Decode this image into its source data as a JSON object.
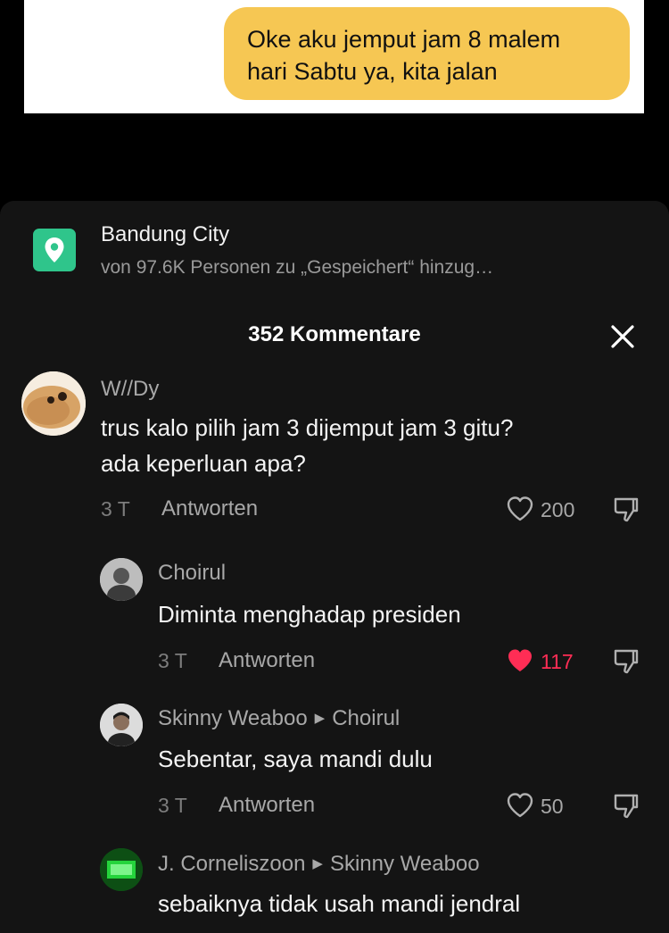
{
  "chat_preview": {
    "bubble_lines": [
      "Oke aku jemput jam 8 malem",
      "hari Sabtu ya, kita jalan"
    ]
  },
  "location": {
    "title": "Bandung City",
    "subtitle": "von 97.6K Personen zu „Gespeichert“ hinzug…",
    "icon": "location-pin-icon",
    "color": "#2fc58b"
  },
  "header": {
    "count_label": "352 Kommentare",
    "close_icon": "close-icon"
  },
  "comments": [
    {
      "user": "W//Dy",
      "text_lines": [
        "trus kalo pilih jam 3 dijemput jam 3 gitu?",
        "ada keperluan apa?"
      ],
      "time": "3 T",
      "reply_label": "Antworten",
      "likes": "200",
      "liked": false
    },
    {
      "user": "Choirul",
      "text_lines": [
        "Diminta menghadap presiden"
      ],
      "time": "3 T",
      "reply_label": "Antworten",
      "likes": "117",
      "liked": true
    },
    {
      "user": "Skinny Weaboo",
      "reply_to": "Choirul",
      "text_lines": [
        "Sebentar, saya mandi dulu"
      ],
      "time": "3 T",
      "reply_label": "Antworten",
      "likes": "50",
      "liked": false
    },
    {
      "user": "J. Corneliszoon",
      "reply_to": "Skinny Weaboo",
      "text_lines": [
        "sebaiknya tidak usah mandi jendral"
      ]
    }
  ],
  "colors": {
    "like_active": "#ff2d55",
    "sheet_bg": "#141414",
    "bubble": "#f6c753"
  }
}
